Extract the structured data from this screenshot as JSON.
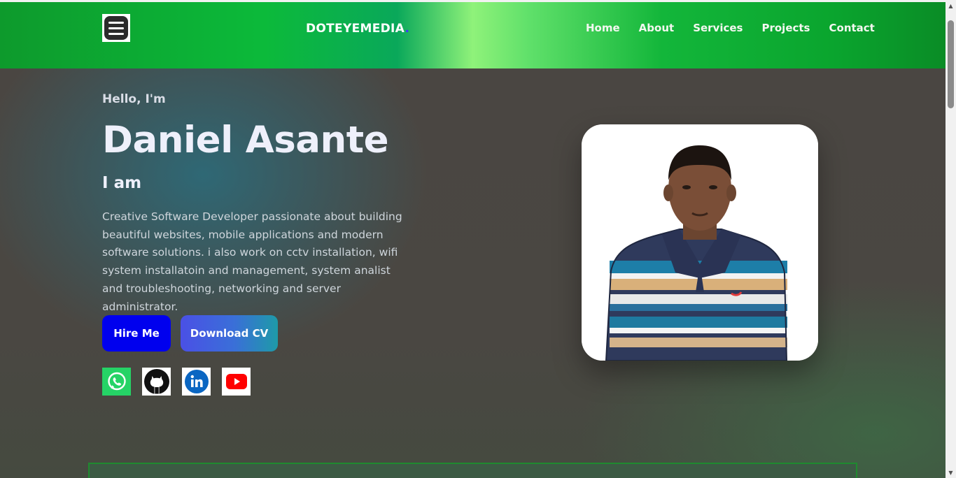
{
  "header": {
    "brand": "DOTEYEMEDIA",
    "brand_dot": ".",
    "menu_icon": "hamburger-menu-icon",
    "nav": [
      {
        "label": "Home"
      },
      {
        "label": "About"
      },
      {
        "label": "Services"
      },
      {
        "label": "Projects"
      },
      {
        "label": "Contact"
      }
    ]
  },
  "hero": {
    "greeting": "Hello, I'm",
    "name": "Daniel Asante",
    "subtitle": "I am",
    "bio": "Creative Software Developer passionate about building beautiful websites, mobile applications and modern software solutions. i also work on cctv installation, wifi system installatoin and management, system analist and troubleshooting, networking and server administrator.",
    "hire_label": "Hire Me",
    "cv_label": "Download CV",
    "socials": [
      {
        "name": "whatsapp-icon"
      },
      {
        "name": "github-icon"
      },
      {
        "name": "linkedin-icon"
      },
      {
        "name": "youtube-icon"
      }
    ]
  },
  "colors": {
    "hire_button": "#0000ee",
    "brand_dot": "#3b3bff",
    "nav_gradient_accent": "#8ff27a"
  }
}
